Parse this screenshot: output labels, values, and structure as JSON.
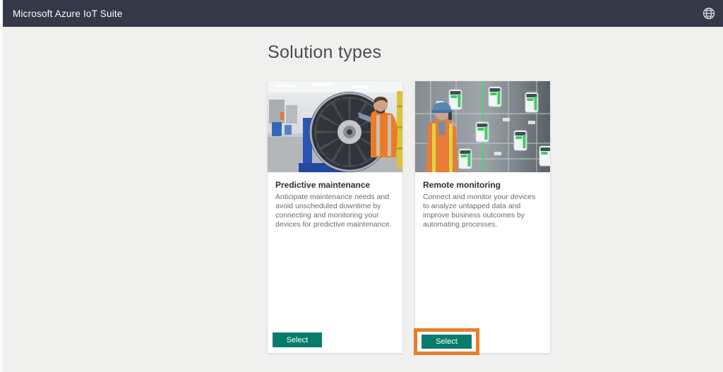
{
  "header": {
    "title": "Microsoft Azure IoT Suite",
    "icon": "globe-icon"
  },
  "page": {
    "heading": "Solution types"
  },
  "cards": [
    {
      "title": "Predictive maintenance",
      "description": "Anticipate maintenance needs and avoid unscheduled downtime by connecting and monitoring your devices for predictive maintenance.",
      "button_label": "Select",
      "image": "jet-engine-technician-photo",
      "highlighted": false
    },
    {
      "title": "Remote monitoring",
      "description": "Connect and monitor your devices to analyze untapped data and improve business outcomes by automating processes.",
      "button_label": "Select",
      "image": "industrial-monitoring-photo",
      "highlighted": true
    }
  ],
  "colors": {
    "header_bg": "#333946",
    "page_bg": "#f0f0ee",
    "button_bg": "#077c6c",
    "highlight": "#e87e2b"
  }
}
